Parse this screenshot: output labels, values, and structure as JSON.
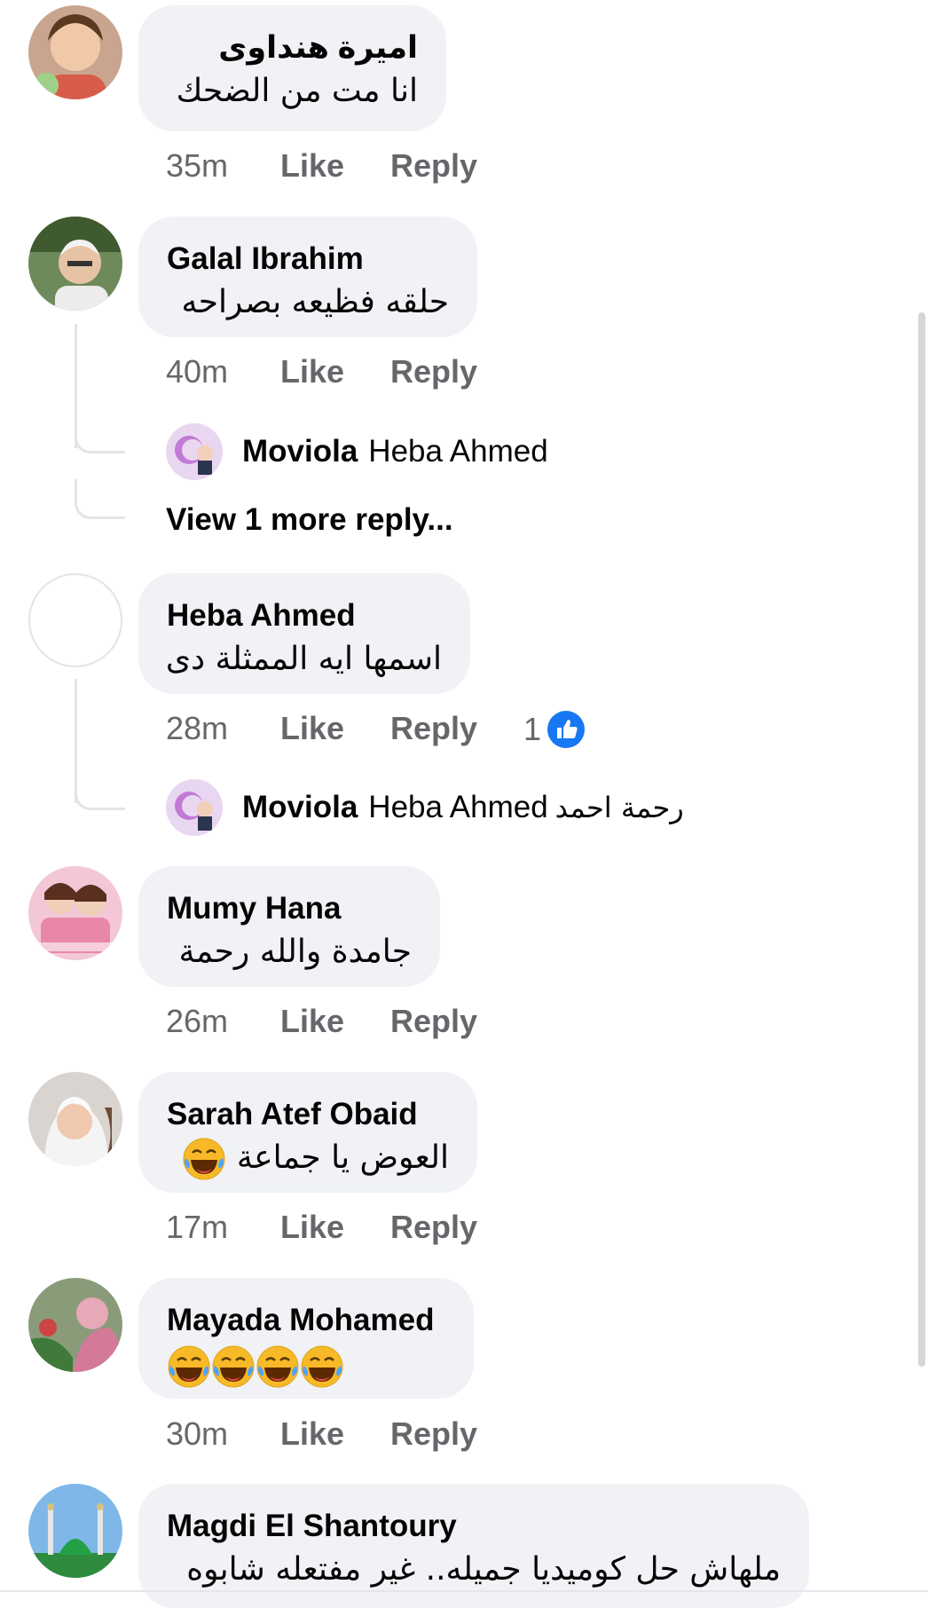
{
  "comments": [
    {
      "name": "اميرة هنداوى",
      "text": "انا مت من الضحك",
      "time": "35m",
      "like": "Like",
      "reply": "Reply"
    },
    {
      "name": "Galal Ibrahim",
      "text": "حلقه فظيعه بصراحه",
      "time": "40m",
      "like": "Like",
      "reply": "Reply",
      "reply_preview": {
        "name": "Moviola",
        "target": "Heba Ahmed",
        "text": ""
      },
      "view_more": "View 1 more reply..."
    },
    {
      "name": "Heba Ahmed",
      "text": "اسمها ايه الممثلة دى",
      "time": "28m",
      "like": "Like",
      "reply": "Reply",
      "reaction_count": "1",
      "reaction_icon": "like-reaction-icon",
      "reply_preview": {
        "name": "Moviola",
        "target": "Heba Ahmed",
        "text": "رحمة احمد"
      }
    },
    {
      "name": "Mumy Hana",
      "text": "جامدة والله رحمة",
      "time": "26m",
      "like": "Like",
      "reply": "Reply"
    },
    {
      "name": "Sarah Atef Obaid",
      "text": "العوض يا جماعة",
      "time": "17m",
      "like": "Like",
      "reply": "Reply",
      "emoji": "laughing-tears-icon"
    },
    {
      "name": "Mayada Mohamed",
      "text": "",
      "time": "30m",
      "like": "Like",
      "reply": "Reply",
      "emoji_count": 4
    },
    {
      "name": "Magdi El Shantoury",
      "text": "ملهاش حل كوميديا جميله.. غير مفتعله شابوه"
    }
  ],
  "colors": {
    "bubble": "#f0f2f5",
    "meta": "#65676b",
    "like_blue": "#1877f2",
    "thread_line": "#e2e4e8"
  }
}
